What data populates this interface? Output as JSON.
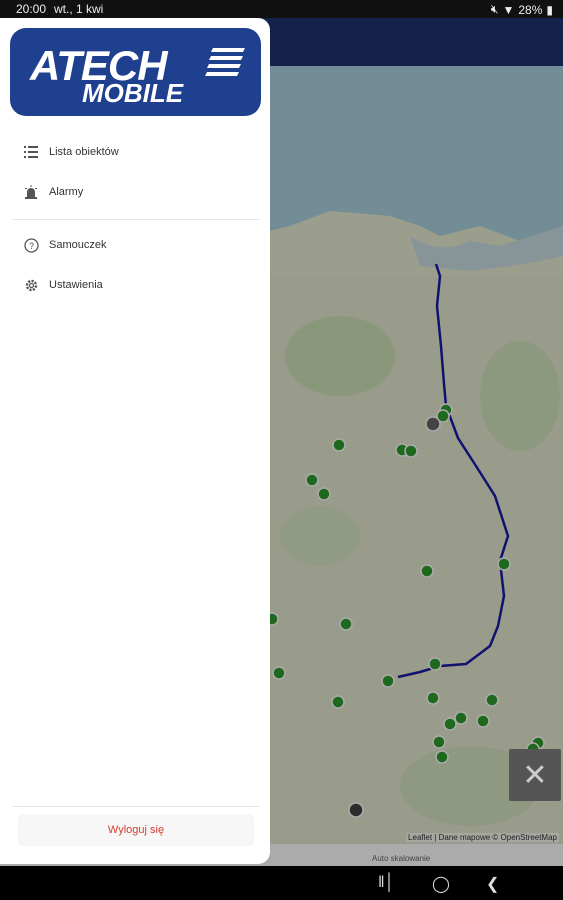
{
  "status_bar": {
    "time": "20:00",
    "date": "wt., 1 kwi",
    "battery": "28%"
  },
  "drawer": {
    "logo": {
      "line1": "ATECH",
      "line2": "MOBILE"
    },
    "items": [
      {
        "label": "Lista obiektów",
        "icon": "list-icon"
      },
      {
        "label": "Alarmy",
        "icon": "siren-icon"
      },
      {
        "label": "Samouczek",
        "icon": "help-icon"
      },
      {
        "label": "Ustawienia",
        "icon": "gear-icon"
      }
    ],
    "logout_label": "Wyloguj się"
  },
  "map": {
    "attribution": "Leaflet | Dane mapowe © OpenStreetMap",
    "route_color": "#1a1aa8",
    "marker_color": "#2e9d2e"
  },
  "bottom_bar": {
    "label": "Auto skalowanie"
  },
  "colors": {
    "brand": "#1f3f8f",
    "header": "#1f3470",
    "logout": "#d63c2f"
  }
}
